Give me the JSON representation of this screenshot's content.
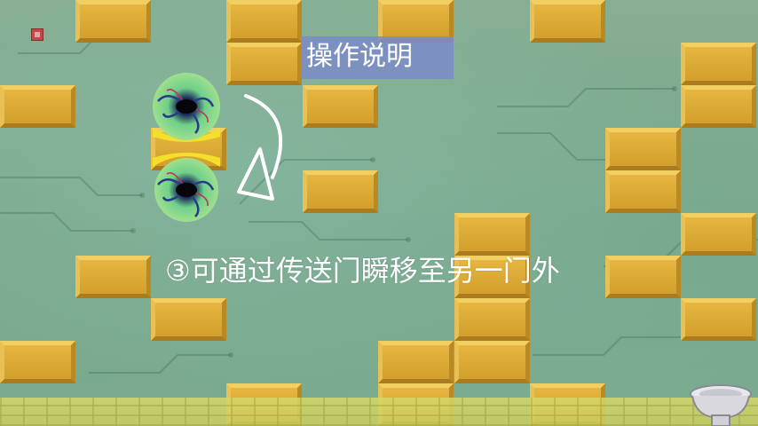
{
  "title": "操作说明",
  "caption": "③可通过传送门瞬移至另一门外",
  "icons": {
    "sound": "sound-icon",
    "portal": "portal-icon",
    "arrow": "curved-arrow-icon",
    "toilet": "toilet-icon"
  },
  "colors": {
    "block": "#dcaa36",
    "title_box": "#7a8cc8",
    "background": "#7aa88c",
    "portal_ring": "#8fd88a",
    "portal_band": "#f2e02a"
  }
}
